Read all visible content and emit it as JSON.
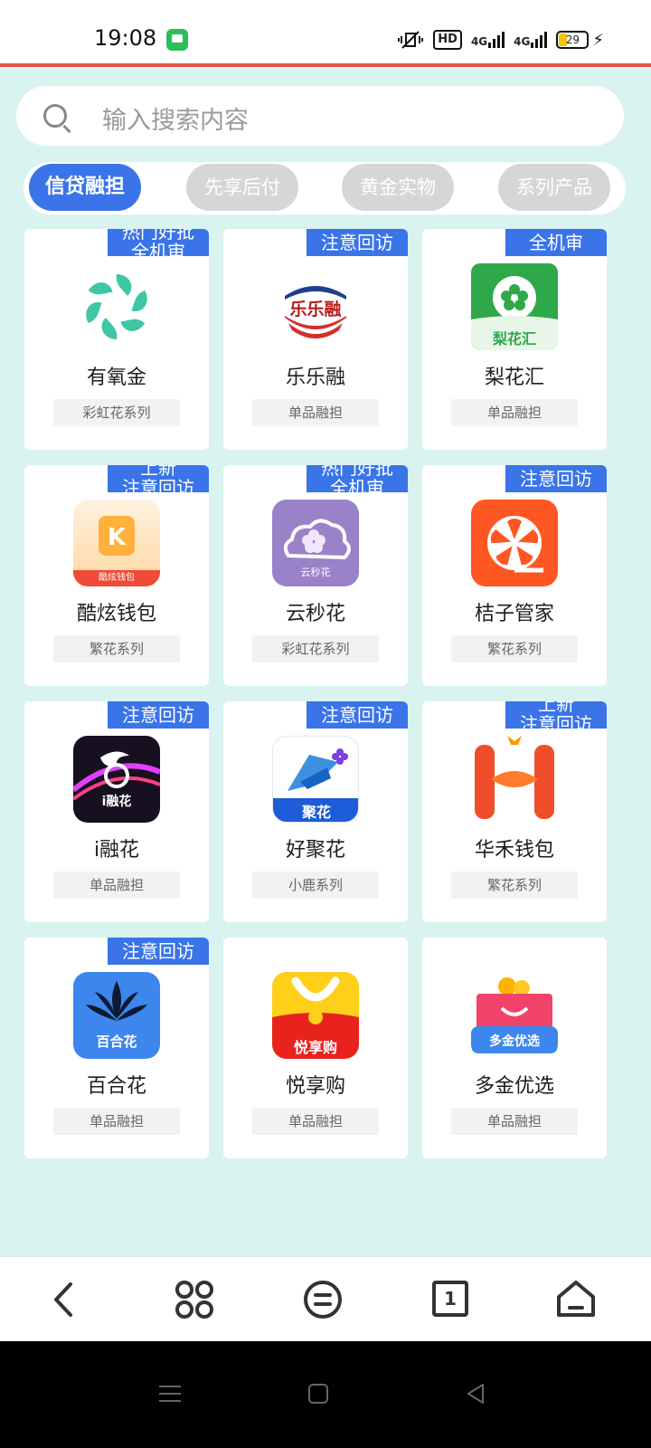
{
  "status_bar": {
    "time": "19:08",
    "hd": "HD",
    "network1": "4G",
    "network2": "4G",
    "battery": "29"
  },
  "search": {
    "placeholder": "输入搜索内容"
  },
  "tabs": [
    {
      "label": "信贷融担",
      "active": true
    },
    {
      "label": "先享后付",
      "active": false
    },
    {
      "label": "黄金实物",
      "active": false
    },
    {
      "label": "系列产品",
      "active": false
    }
  ],
  "colors": {
    "background": "#d9f3f0",
    "accent": "#3a74e8",
    "tab_inactive": "#d6d6d6",
    "status_red_line": "#e5534b"
  },
  "apps": [
    {
      "name": "有氧金",
      "series": "彩虹花系列",
      "badge": [
        "热门好批",
        "全机审"
      ],
      "icon": "youyangjin-icon"
    },
    {
      "name": "乐乐融",
      "series": "单品融担",
      "badge": [
        "注意回访"
      ],
      "icon": "lelerong-icon",
      "icon_text": "乐乐融"
    },
    {
      "name": "梨花汇",
      "series": "单品融担",
      "badge": [
        "全机审"
      ],
      "icon": "lihuahui-icon",
      "icon_text": "梨花汇"
    },
    {
      "name": "酷炫钱包",
      "series": "繁花系列",
      "badge": [
        "上新",
        "注意回访"
      ],
      "icon": "kuxuan-icon",
      "icon_text": "酷炫钱包"
    },
    {
      "name": "云秒花",
      "series": "彩虹花系列",
      "badge": [
        "热门好批",
        "全机审"
      ],
      "icon": "yunmiaohua-icon",
      "icon_text": "云秒花"
    },
    {
      "name": "桔子管家",
      "series": "繁花系列",
      "badge": [
        "注意回访"
      ],
      "icon": "juzi-icon"
    },
    {
      "name": "i融花",
      "series": "单品融担",
      "badge": [
        "注意回访"
      ],
      "icon": "irong-icon",
      "icon_text": "i融花"
    },
    {
      "name": "好聚花",
      "series": "小鹿系列",
      "badge": [
        "注意回访"
      ],
      "icon": "haojuhua-icon",
      "icon_text": "聚花"
    },
    {
      "name": "华禾钱包",
      "series": "繁花系列",
      "badge": [
        "上新",
        "注意回访"
      ],
      "icon": "huahe-icon"
    },
    {
      "name": "百合花",
      "series": "单品融担",
      "badge": [
        "注意回访"
      ],
      "icon": "baihehua-icon",
      "icon_text": "百合花"
    },
    {
      "name": "悦享购",
      "series": "单品融担",
      "badge": [],
      "icon": "yuexiang-icon",
      "icon_text": "悦享购"
    },
    {
      "name": "多金优选",
      "series": "单品融担",
      "badge": [],
      "icon": "duojin-icon",
      "icon_text": "多金优选"
    }
  ],
  "bottom_nav": {
    "page_count": "1"
  }
}
